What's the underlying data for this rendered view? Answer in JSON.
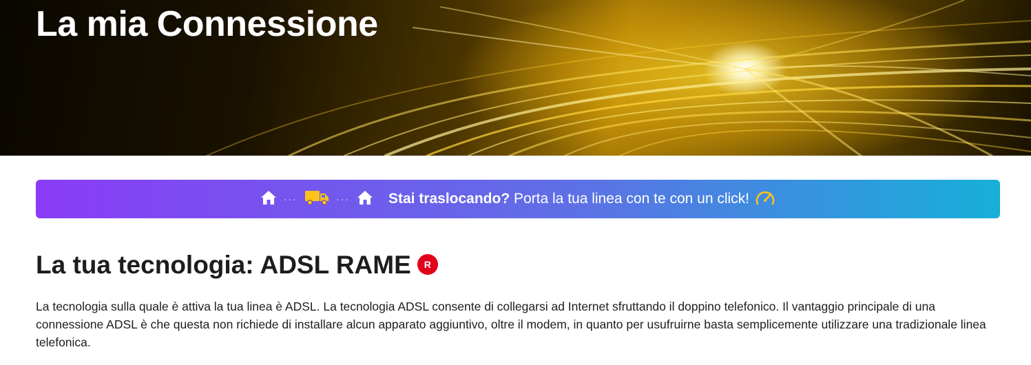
{
  "hero": {
    "title": "La mia Connessione"
  },
  "banner": {
    "bold_text": "Stai traslocando?",
    "text": " Porta la tua linea con te con un click!",
    "icons": [
      "home-icon",
      "truck-icon",
      "home-icon",
      "speedometer-icon"
    ],
    "gradient_start": "#8a3cf6",
    "gradient_end": "#17b0d8"
  },
  "technology": {
    "title": "La tua tecnologia: ADSL RAME",
    "badge_letter": "R",
    "badge_color": "#e3001b",
    "description": "La tecnologia sulla quale è attiva la tua linea è ADSL. La tecnologia ADSL consente di collegarsi ad Internet sfruttando il doppino telefonico. Il vantaggio principale di una connessione ADSL è che questa non richiede di installare alcun apparato aggiuntivo, oltre il modem, in quanto per usufruirne basta semplicemente utilizzare una tradizionale linea telefonica."
  }
}
